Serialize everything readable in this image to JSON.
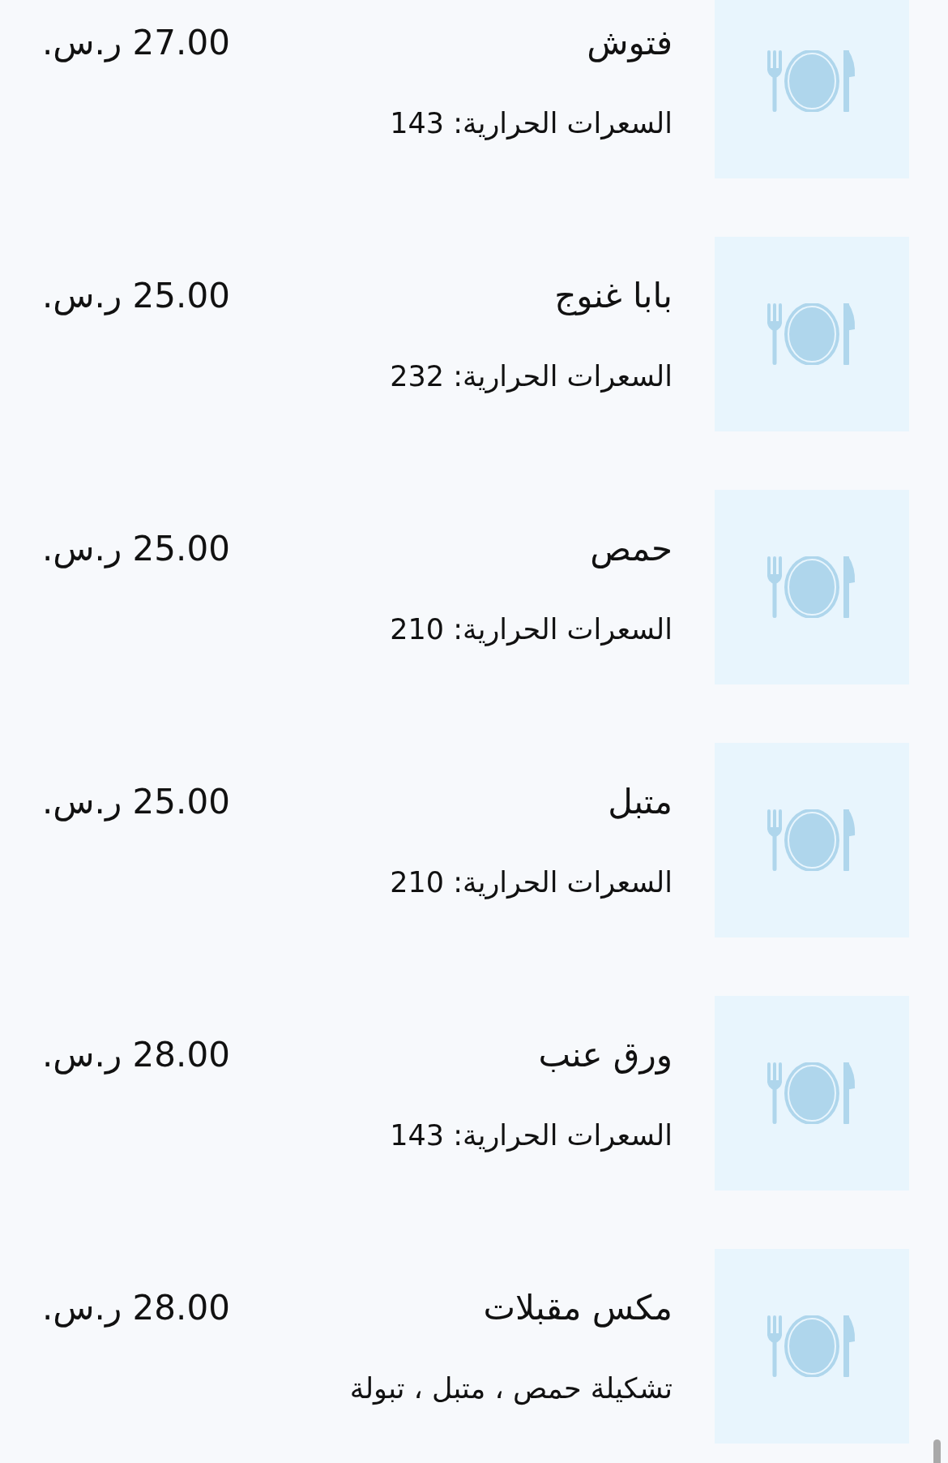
{
  "items": [
    {
      "name": "فتوش",
      "detail": "السعرات الحرارية: 143",
      "price": "27.00 ر.س."
    },
    {
      "name": "بابا غنوج",
      "detail": "السعرات الحرارية: 232",
      "price": "25.00 ر.س."
    },
    {
      "name": "حمص",
      "detail": "السعرات الحرارية: 210",
      "price": "25.00 ر.س."
    },
    {
      "name": "متبل",
      "detail": "السعرات الحرارية: 210",
      "price": "25.00 ر.س."
    },
    {
      "name": "ورق عنب",
      "detail": "السعرات الحرارية: 143",
      "price": "28.00 ر.س."
    },
    {
      "name": "مكس مقبلات",
      "detail": "تشكيلة حمص ، متبل ، تبولة",
      "price": "28.00 ر.س."
    }
  ]
}
